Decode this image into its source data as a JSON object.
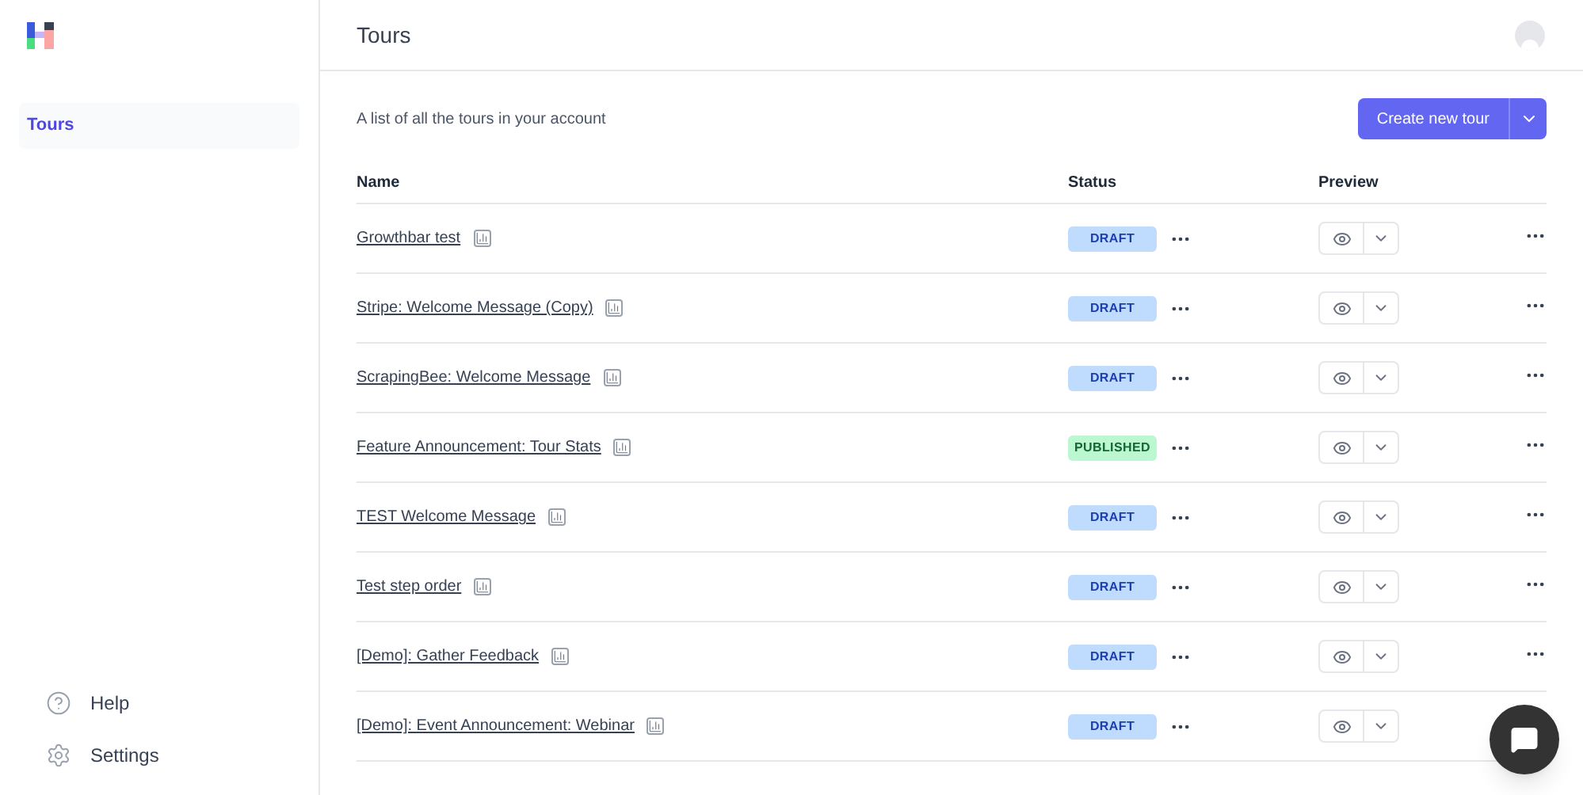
{
  "sidebar": {
    "items": [
      {
        "label": "Tours",
        "selected": true
      }
    ],
    "footer": [
      {
        "label": "Help",
        "kind": "help"
      },
      {
        "label": "Settings",
        "kind": "settings"
      }
    ]
  },
  "header": {
    "title": "Tours"
  },
  "intro": "A list of all the tours in your account",
  "create_button": "Create new tour",
  "table": {
    "columns": [
      "Name",
      "Status",
      "Preview"
    ],
    "rows": [
      {
        "name": "Growthbar test",
        "status": "DRAFT",
        "kind": "draft"
      },
      {
        "name": "Stripe: Welcome Message (Copy)",
        "status": "DRAFT",
        "kind": "draft"
      },
      {
        "name": "ScrapingBee: Welcome Message",
        "status": "DRAFT",
        "kind": "draft"
      },
      {
        "name": "Feature Announcement: Tour Stats",
        "status": "PUBLISHED",
        "kind": "published"
      },
      {
        "name": "TEST Welcome Message",
        "status": "DRAFT",
        "kind": "draft"
      },
      {
        "name": "Test step order",
        "status": "DRAFT",
        "kind": "draft"
      },
      {
        "name": "[Demo]: Gather Feedback",
        "status": "DRAFT",
        "kind": "draft"
      },
      {
        "name": "[Demo]: Event Announcement: Webinar",
        "status": "DRAFT",
        "kind": "draft"
      }
    ]
  }
}
